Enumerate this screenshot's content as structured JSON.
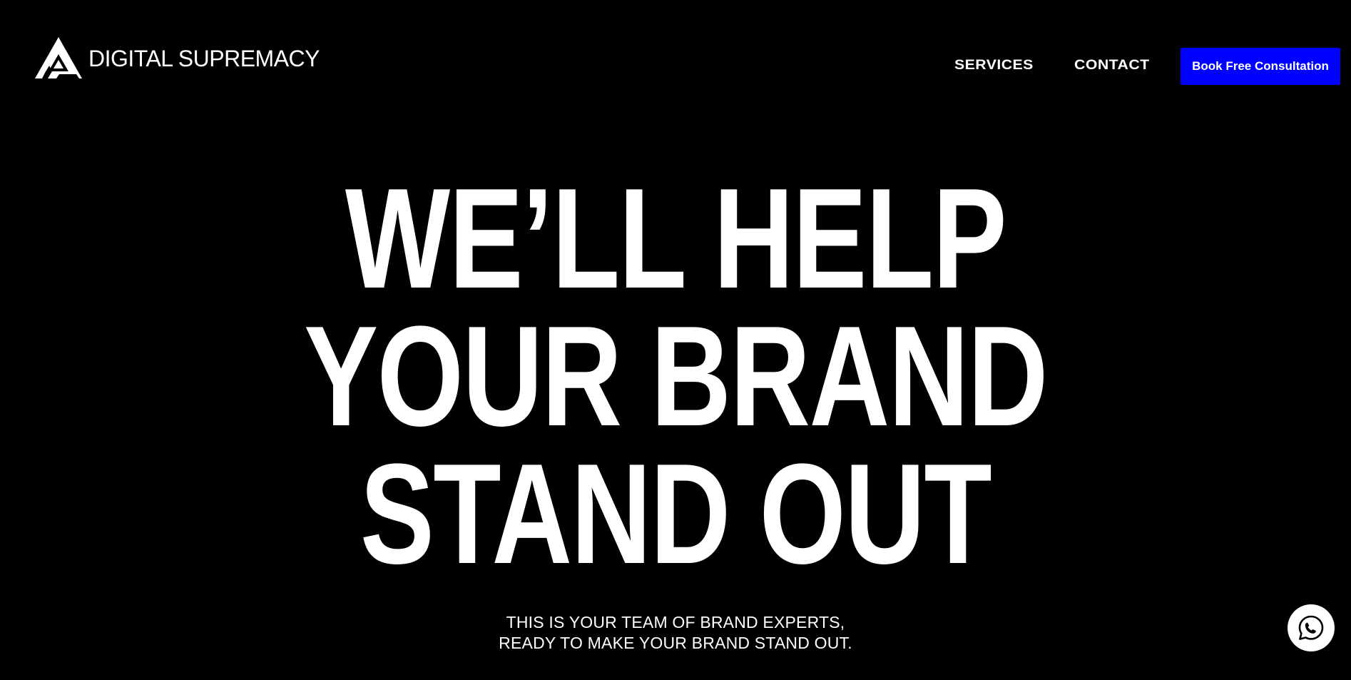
{
  "header": {
    "logo_text": "DIGITAL SUPREMACY",
    "logo_icon": "triangle-logo-icon",
    "nav": {
      "services_label": "SERVICES",
      "contact_label": "CONTACT"
    },
    "cta_label": "Book Free Consultation"
  },
  "hero": {
    "title_lines": [
      "WE’LL HELP",
      "YOUR BRAND",
      "STAND OUT"
    ],
    "subtitle_lines": [
      "THIS IS YOUR TEAM OF BRAND EXPERTS,",
      "READY TO MAKE YOUR BRAND STAND OUT."
    ]
  },
  "floating": {
    "whatsapp_icon": "whatsapp-icon"
  },
  "colors": {
    "background": "#000000",
    "text": "#ffffff",
    "cta_background": "#0000fe"
  }
}
